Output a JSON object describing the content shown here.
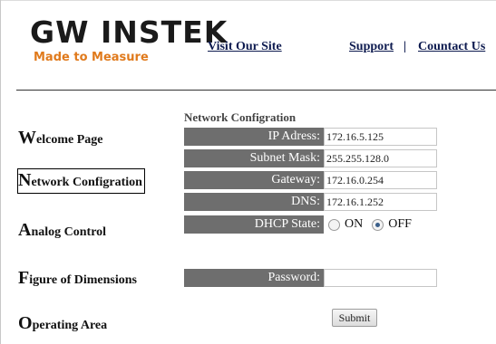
{
  "header": {
    "brand_name": "GW INSTEK",
    "brand_tagline": "Made to Measure",
    "links": {
      "visit_site": "Visit Our Site",
      "support": "Support",
      "separator": "|",
      "contact": "Countact Us"
    }
  },
  "nav": {
    "items": [
      {
        "initial": "W",
        "rest": "elcome Page"
      },
      {
        "initial": "N",
        "rest": "etwork Configration"
      },
      {
        "initial": "A",
        "rest": "nalog Control"
      },
      {
        "initial": "F",
        "rest": "igure of Dimensions"
      },
      {
        "initial": "O",
        "rest": "perating Area"
      }
    ]
  },
  "form": {
    "title": "Network Configration",
    "ip": {
      "label": "IP Adress:",
      "value": "172.16.5.125"
    },
    "subnet": {
      "label": "Subnet Mask:",
      "value": "255.255.128.0"
    },
    "gateway": {
      "label": "Gateway:",
      "value": "172.16.0.254"
    },
    "dns": {
      "label": "DNS:",
      "value": "172.16.1.252"
    },
    "dhcp": {
      "label": "DHCP State:",
      "on_label": "ON",
      "off_label": "OFF",
      "selected": "OFF"
    },
    "password": {
      "label": "Password:",
      "value": ""
    },
    "submit_label": "Submit"
  },
  "colors": {
    "label_bg": "#6e6e6e",
    "link": "#0d1a4f",
    "brand_tagline": "#e07a1c"
  }
}
